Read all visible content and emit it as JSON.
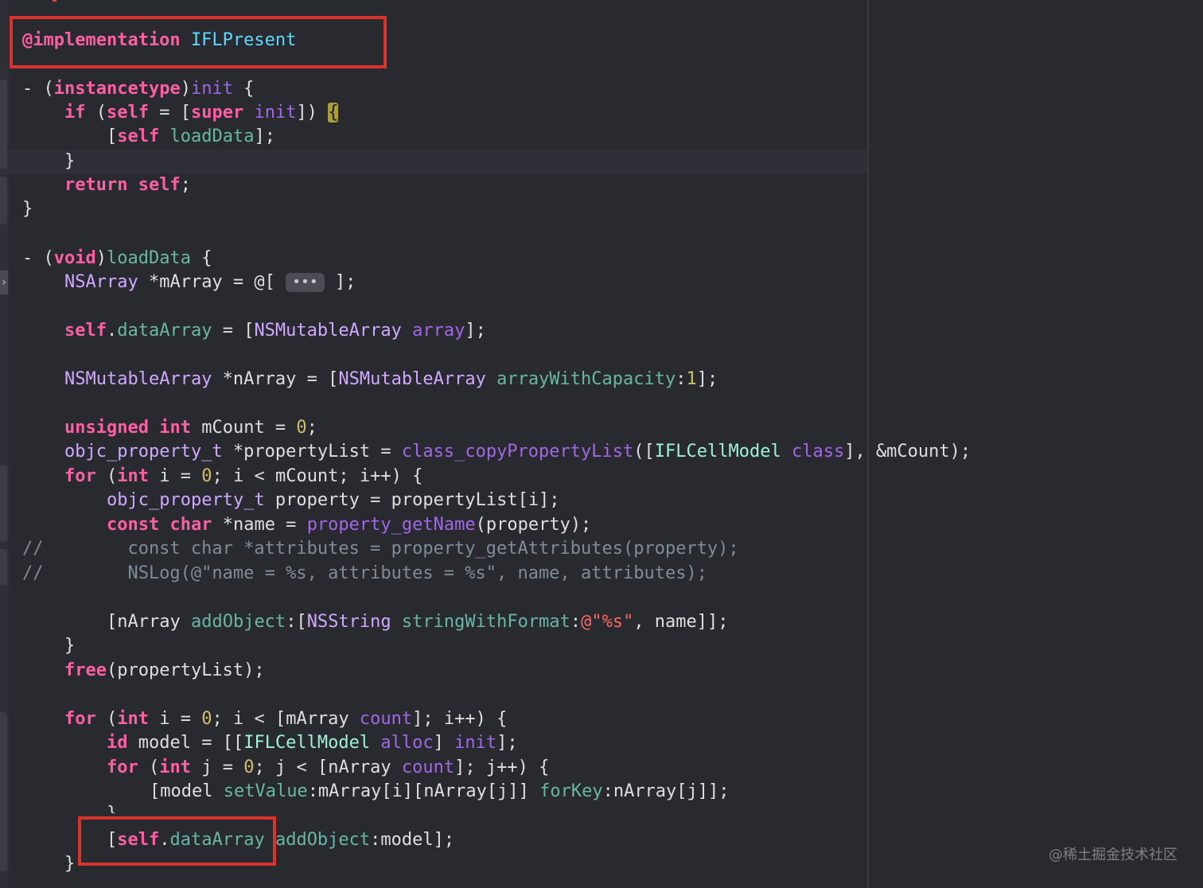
{
  "editor": {
    "collapsed_placeholder": "•••",
    "lines": {
      "l_impl_kw": "@implementation",
      "l_impl_name": "IFLPresent",
      "l_init": "- (instancetype)init {",
      "l_if": "if (self = [super init]) {",
      "l_load_call": "[self loadData];",
      "l_close_if": "}",
      "l_return": "return self;",
      "l_close_init": "}",
      "l_loaddata": "- (void)loadData {",
      "l_marray": "NSArray *mArray = @[ ••• ];",
      "l_dataarray": "self.dataArray = [NSMutableArray array];",
      "l_narray": "NSMutableArray *nArray = [NSMutableArray arrayWithCapacity:1];",
      "l_mcount": "unsigned int mCount = 0;",
      "l_proplist": "objc_property_t *propertyList = class_copyPropertyList([IFLCellModel class], &mCount);",
      "l_for1": "for (int i = 0; i < mCount; i++) {",
      "l_property": "objc_property_t property = propertyList[i];",
      "l_name": "const char *name = property_getName(property);",
      "l_cmt1": "//        const char *attributes = property_getAttributes(property);",
      "l_cmt2": "//        NSLog(@\"name = %s, attributes = %s\", name, attributes);",
      "l_addobj": "[nArray addObject:[NSString stringWithFormat:@\"%s\", name]];",
      "l_close_for1": "}",
      "l_free": "free(propertyList);",
      "l_for2": "for (int i = 0; i < [mArray count]; i++) {",
      "l_model": "id model = [[IFLCellModel alloc] init];",
      "l_for3": "for (int j = 0; j < [nArray count]; j++) {",
      "l_setvalue": "[model setValue:mArray[i][nArray[j]] forKey:nArray[j]];",
      "l_close_for3": "}",
      "l_add_model": "[self.dataArray addObject:model];",
      "l_close_for2": "}"
    }
  },
  "watermark": "@稀土掘金技术社区",
  "colors": {
    "background": "#292a30",
    "keyword": "#fc5fa3",
    "plain": "#dfdfe0",
    "project_method": "#67b7a4",
    "system_method": "#a167e6",
    "number": "#d0bf69",
    "string": "#fc6a5d",
    "comment": "#7f8c98",
    "highlight_box": "#d9342b"
  }
}
